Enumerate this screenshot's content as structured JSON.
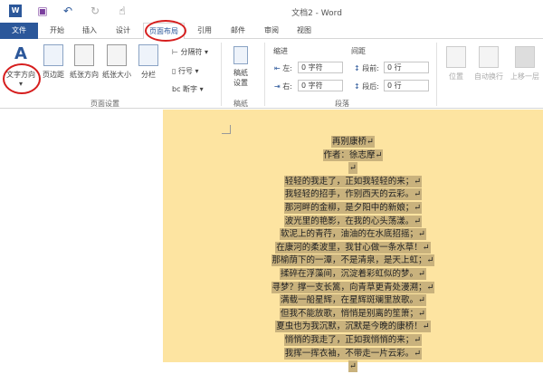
{
  "window": {
    "title": "文档2 - Word"
  },
  "quick_access": [
    "word-logo-icon",
    "save-icon",
    "undo-icon",
    "redo-icon",
    "touch-mode-icon"
  ],
  "tabs": {
    "file": "文件",
    "items": [
      "开始",
      "插入",
      "设计",
      "页面布局",
      "引用",
      "邮件",
      "审阅",
      "视图"
    ],
    "active": "页面布局"
  },
  "ribbon": {
    "page_setup": {
      "label": "页面设置",
      "text_direction": "文字方向",
      "margins": "页边距",
      "orientation": "纸张方向",
      "size": "纸张大小",
      "columns": "分栏",
      "breaks": "分隔符",
      "line_numbers": "行号",
      "hyphenation": "断字"
    },
    "draft": {
      "label": "稿纸",
      "settings": "稿纸\n设置"
    },
    "paragraph": {
      "label": "段落",
      "indent": "缩进",
      "spacing": "间距",
      "left_label": "左:",
      "left_value": "0 字符",
      "right_label": "右:",
      "right_value": "0 字符",
      "before_label": "段前:",
      "before_value": "0 行",
      "after_label": "段后:",
      "after_value": "0 行"
    },
    "arrange": {
      "position": "位置",
      "wrap": "自动换行",
      "bring_forward": "上移一层"
    }
  },
  "document": {
    "lines": [
      "再别康桥↵",
      "作者：徐志摩↵",
      "↵",
      "轻轻的我走了，正如我轻轻的来；↵",
      "我轻轻的招手，作别西天的云彩。↵",
      "那河畔的金柳，是夕阳中的新娘；↵",
      "波光里的艳影，在我的心头荡漾。↵",
      "软泥上的青荇，油油的在水底招摇；↵",
      "在康河的柔波里，我甘心做一条水草！↵",
      "那榆荫下的一潭，不是清泉，是天上虹；↵",
      "揉碎在浮藻间，沉淀着彩虹似的梦。↵",
      "寻梦？撑一支长篙，向青草更青处漫溯；↵",
      "满载一船星辉，在星辉斑斓里放歌。↵",
      "但我不能放歌，悄悄是别离的笙箫；↵",
      "夏虫也为我沉默，沉默是今晚的康桥！↵",
      "悄悄的我走了，正如我悄悄的来；↵",
      "我挥一挥衣袖，不带走一片云彩。↵",
      "↵"
    ]
  },
  "colors": {
    "accent": "#2b579a",
    "page": "#fde4a1",
    "highlight": "#c9b27d",
    "annotation": "#d61e1e"
  }
}
